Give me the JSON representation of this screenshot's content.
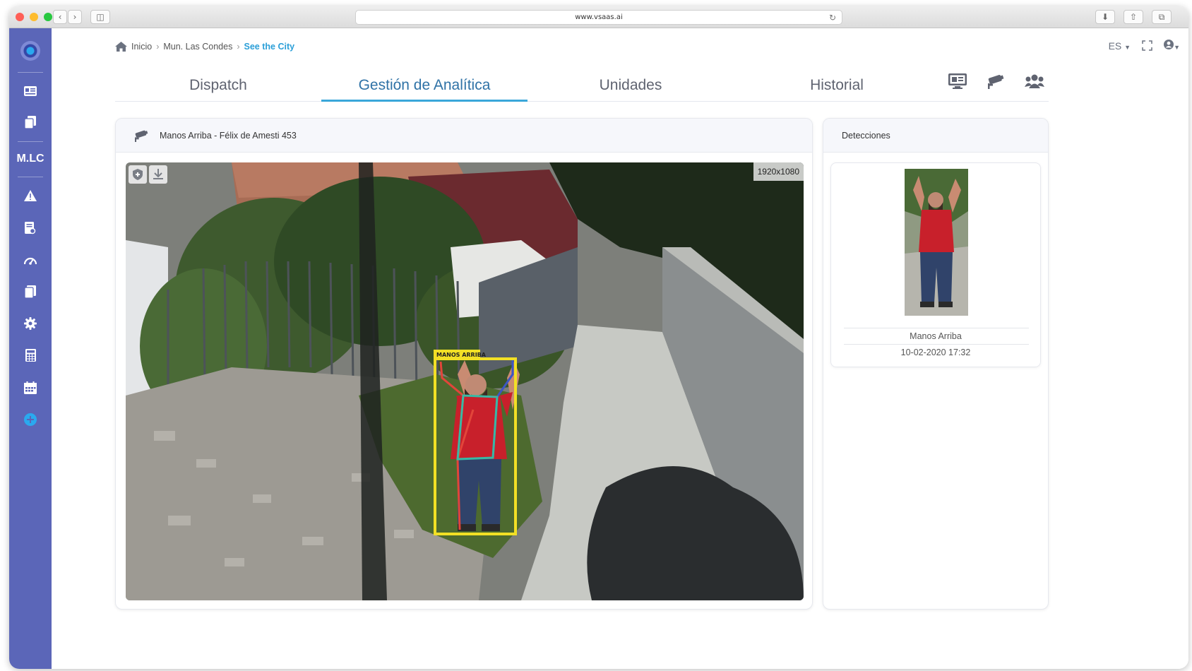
{
  "browser": {
    "url": "www.vsaas.ai"
  },
  "sidebar": {
    "brand_label": "M.LC",
    "items": [
      {
        "icon": "id-card-icon"
      },
      {
        "icon": "copy-icon"
      },
      {
        "icon": "warning-icon"
      },
      {
        "icon": "document-search-icon"
      },
      {
        "icon": "gauge-icon"
      },
      {
        "icon": "documents-icon"
      },
      {
        "icon": "gear-icon"
      },
      {
        "icon": "calculator-icon"
      },
      {
        "icon": "calendar-icon"
      },
      {
        "icon": "plus-circle-icon"
      }
    ],
    "accent": "#5b66b8",
    "plus_color": "#2aa9ef"
  },
  "breadcrumb": {
    "home": "Inicio",
    "level1": "Mun. Las Condes",
    "current": "See the City"
  },
  "topbar": {
    "language": "ES"
  },
  "tabs": [
    {
      "label": "Dispatch",
      "active": false
    },
    {
      "label": "Gestión de Analítica",
      "active": true
    },
    {
      "label": "Unidades",
      "active": false
    },
    {
      "label": "Historial",
      "active": false
    }
  ],
  "camera_panel": {
    "title": "Manos Arriba - Félix de Amesti 453",
    "resolution": "1920x1080",
    "detection_label": "MANOS ARRIBA"
  },
  "detections_panel": {
    "title": "Detecciones",
    "items": [
      {
        "label": "Manos Arriba",
        "timestamp": "10-02-2020 17:32"
      }
    ]
  }
}
